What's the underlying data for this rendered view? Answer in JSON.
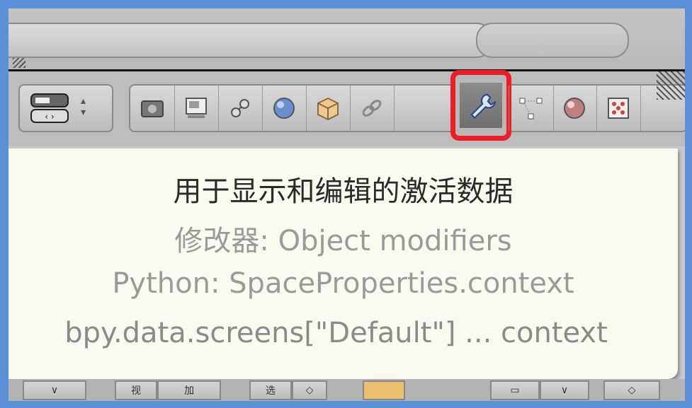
{
  "toolbar": {
    "buttons": [
      {
        "name": "render-icon"
      },
      {
        "name": "render-layers-icon"
      },
      {
        "name": "scene-icon"
      },
      {
        "name": "world-icon"
      },
      {
        "name": "object-icon"
      },
      {
        "name": "constraints-icon"
      },
      {
        "name": "modifiers-icon",
        "active": true
      },
      {
        "name": "object-data-icon"
      },
      {
        "name": "material-icon"
      },
      {
        "name": "texture-icon"
      }
    ],
    "highlight_color": "#ee1c24"
  },
  "tooltip": {
    "title": "用于显示和编辑的激活数据",
    "description": "修改器: Object modifiers",
    "python": "Python: SpaceProperties.context",
    "path": "bpy.data.screens[\"Default\"] ... context"
  },
  "bottom_strip": {
    "items": [
      "∨",
      "视",
      "加",
      "选",
      "◇",
      "▭",
      "▭",
      "∨",
      "◇"
    ]
  }
}
